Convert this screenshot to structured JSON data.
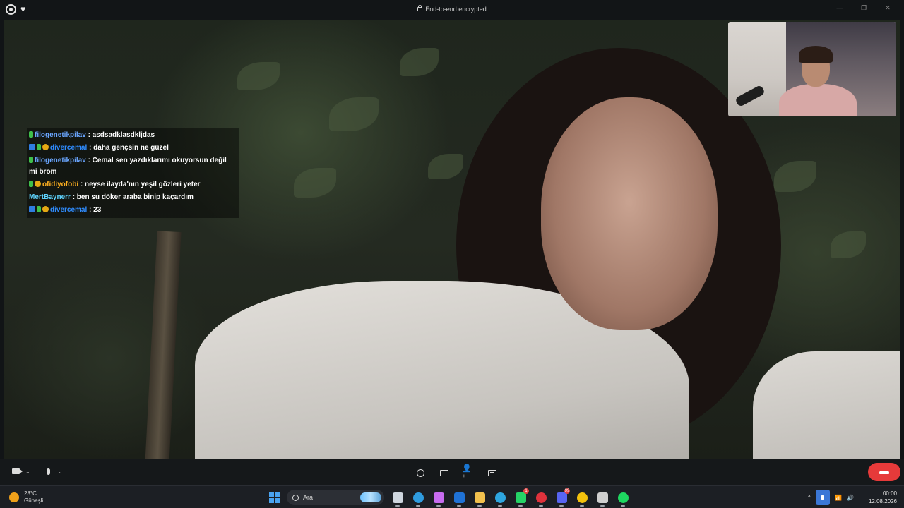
{
  "window": {
    "title": "End-to-end encrypted",
    "icons": [
      "whatsapp-icon",
      "heart-icon"
    ],
    "controls": [
      "minimize-icon",
      "restore-icon",
      "close-icon"
    ]
  },
  "chat": {
    "messages": [
      {
        "user": "filogenetikpilav",
        "text": ": asdsadklasdkljdas",
        "user_color": "#6aa6ff",
        "badges": [
          "green"
        ]
      },
      {
        "user": "divercemal",
        "text": ": daha gençsin ne güzel",
        "user_color": "#2f8cff",
        "badges": [
          "blue",
          "green",
          "gold"
        ]
      },
      {
        "user": "filogenetikpilav",
        "text": ": Cemal sen yazdıklarımı okuyorsun değil mi brom",
        "user_color": "#6aa6ff",
        "badges": [
          "green"
        ]
      },
      {
        "user": "ofidiyofobi",
        "text": ": neyse ilayda'nın yeşil gözleri yeter",
        "user_color": "#ffb020",
        "badges": [
          "green",
          "gold"
        ]
      },
      {
        "user": "MertBaynerr",
        "text": ": ben su döker araba binip kaçardım",
        "user_color": "#5fd4ff",
        "badges": []
      },
      {
        "user": "divercemal",
        "text": ": 23",
        "user_color": "#2f8cff",
        "badges": [
          "blue",
          "green",
          "gold"
        ]
      }
    ]
  },
  "call_controls": {
    "left": [
      "camera-icon",
      "mic-icon"
    ],
    "center": [
      "emoji-icon",
      "screen-share-icon",
      "add-participant-icon",
      "more-icon"
    ],
    "end_call": "end-call-icon",
    "colors": {
      "end_call": "#e63a3a"
    }
  },
  "taskbar": {
    "weather": {
      "temp": "28°C",
      "condition": "Güneşli"
    },
    "search_placeholder": "Ara",
    "apps": [
      {
        "name": "file-explorer-icon",
        "color": "#cfd6df",
        "badge": ""
      },
      {
        "name": "edge-icon",
        "color": "#2f9ce0",
        "badge": ""
      },
      {
        "name": "copilot-icon",
        "color": "#c86cf0",
        "badge": ""
      },
      {
        "name": "outlook-icon",
        "color": "#1f72d6",
        "badge": ""
      },
      {
        "name": "folder-icon",
        "color": "#f2c14e",
        "badge": ""
      },
      {
        "name": "telegram-icon",
        "color": "#2ea6e0",
        "badge": ""
      },
      {
        "name": "whatsapp-icon",
        "color": "#25d366",
        "badge": "1"
      },
      {
        "name": "opera-icon",
        "color": "#e0323c",
        "badge": ""
      },
      {
        "name": "discord-icon",
        "color": "#5865f2",
        "badge": "99"
      },
      {
        "name": "chrome-icon",
        "color": "#f4c20d",
        "badge": ""
      },
      {
        "name": "obs-icon",
        "color": "#cfcfcf",
        "badge": ""
      },
      {
        "name": "spotify-icon",
        "color": "#1ed760",
        "badge": ""
      }
    ],
    "tray": {
      "time": "00:00",
      "date": "12.08.2026"
    }
  }
}
